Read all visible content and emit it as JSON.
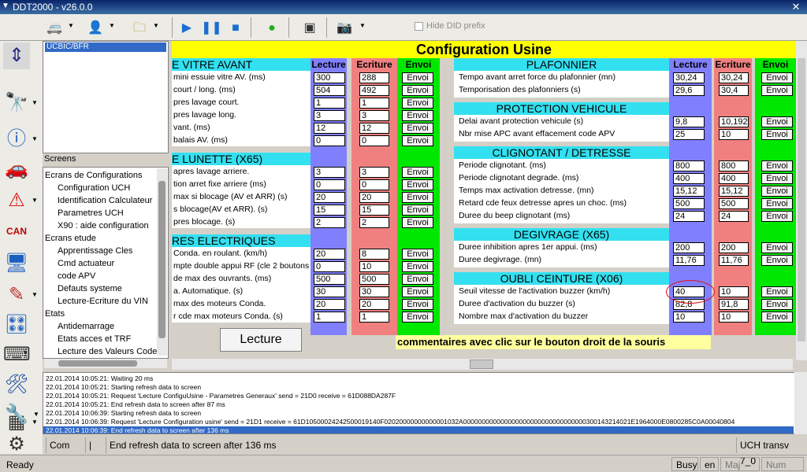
{
  "window": {
    "title": "DDT2000 - v26.0.0",
    "close": "✕"
  },
  "toolbar": {
    "hide_did_prefix": "Hide DID prefix"
  },
  "tree": {
    "selected": "UCBIC/BFR",
    "screens_label": "Screens",
    "items": [
      "Ecrans de Configurations",
      "Configuration UCH",
      "Identification Calculateur",
      "Parametres UCH",
      "X90 : aide configuration",
      "Ecrans etude",
      "Apprentissage Cles",
      "Cmd actuateur",
      "code APV",
      "Defauts systeme",
      "Lecture-Ecriture du VIN",
      "Etats",
      "Antidemarrage",
      "Etats acces et TRF",
      "Lecture des Valeurs Codee"
    ]
  },
  "main": {
    "title": "Configuration Usine",
    "lecture_button": "Lecture",
    "comment": "commentaires avec clic sur le bouton droit de la souris",
    "col_headers": {
      "lecture": "Lecture",
      "ecriture": "Ecriture",
      "envoi": "Envoi"
    },
    "envoi": "Envoi",
    "left": {
      "sections": [
        "E VITRE AVANT",
        "E LUNETTE (X65)",
        "RES ELECTRIQUES"
      ],
      "rows": [
        {
          "label": "mini essuie vitre AV. (ms)",
          "lecture": "300",
          "ecriture": "288"
        },
        {
          "label": "court / long. (ms)",
          "lecture": "504",
          "ecriture": "492"
        },
        {
          "label": "pres lavage court.",
          "lecture": "1",
          "ecriture": "1"
        },
        {
          "label": "pres lavage long.",
          "lecture": "3",
          "ecriture": "3"
        },
        {
          "label": "vant. (ms)",
          "lecture": "12",
          "ecriture": "12"
        },
        {
          "label": "balais AV. (ms)",
          "lecture": "0",
          "ecriture": "0"
        },
        {
          "label": "apres lavage arriere.",
          "lecture": "3",
          "ecriture": "3"
        },
        {
          "label": "tion arret fixe arriere (ms)",
          "lecture": "0",
          "ecriture": "0"
        },
        {
          "label": "max si blocage (AV et ARR) (s)",
          "lecture": "20",
          "ecriture": "20"
        },
        {
          "label": "s blocage(AV et ARR). (s)",
          "lecture": "15",
          "ecriture": "15"
        },
        {
          "label": "pres blocage. (s)",
          "lecture": "2",
          "ecriture": "2"
        },
        {
          "label": "Conda. en roulant. (km/h)",
          "lecture": "20",
          "ecriture": "8"
        },
        {
          "label": "mpte double appui RF (cle 2 boutons)",
          "lecture": "0",
          "ecriture": "10"
        },
        {
          "label": "de max des ouvrants. (ms)",
          "lecture": "500",
          "ecriture": "500"
        },
        {
          "label": "a. Automatique. (s)",
          "lecture": "30",
          "ecriture": "30"
        },
        {
          "label": "max des moteurs Conda.",
          "lecture": "20",
          "ecriture": "20"
        },
        {
          "label": "r cde max moteurs Conda. (s)",
          "lecture": "1",
          "ecriture": "1"
        }
      ]
    },
    "right": {
      "sections": [
        "PLAFONNIER",
        "PROTECTION VEHICULE",
        "CLIGNOTANT /  DETRESSE",
        "DEGIVRAGE (X65)",
        "OUBLI CEINTURE (X06)"
      ],
      "rows": [
        {
          "label": "Tempo avant arret force du plafonnier (mn)",
          "lecture": "30,24",
          "ecriture": "30,24"
        },
        {
          "label": "Temporisation des plafonniers (s)",
          "lecture": "29,6",
          "ecriture": "30,4"
        },
        {
          "label": "Delai avant protection vehicule (s)",
          "lecture": "9,8",
          "ecriture": "10,192"
        },
        {
          "label": "Nbr mise APC avant effacement code APV",
          "lecture": "25",
          "ecriture": "10"
        },
        {
          "label": "Periode clignotant. (ms)",
          "lecture": "800",
          "ecriture": "800"
        },
        {
          "label": "Periode clignotant degrade. (ms)",
          "lecture": "400",
          "ecriture": "400"
        },
        {
          "label": "Temps max activation detresse. (mn)",
          "lecture": "15,12",
          "ecriture": "15,12"
        },
        {
          "label": "Retard cde feux detresse apres un choc. (ms)",
          "lecture": "500",
          "ecriture": "500"
        },
        {
          "label": "Duree du beep clignotant (ms)",
          "lecture": "24",
          "ecriture": "24"
        },
        {
          "label": "Duree inhibition apres 1er appui. (ms)",
          "lecture": "200",
          "ecriture": "200"
        },
        {
          "label": "Duree degivrage. (mn)",
          "lecture": "11,76",
          "ecriture": "11,76"
        },
        {
          "label": "Seuil vitesse de l'activation buzzer (km/h)",
          "lecture": "40",
          "ecriture": "10"
        },
        {
          "label": "Duree d'activation du buzzer (s)",
          "lecture": "82,8",
          "ecriture": "91,8"
        },
        {
          "label": "Nombre max d'activation du buzzer",
          "lecture": "10",
          "ecriture": "10"
        }
      ]
    }
  },
  "log": [
    "22.01.2014 10:05:21: Waiting 20 ms",
    "22.01.2014 10:05:21: Starting refresh data to screen",
    "22.01.2014 10:05:21: Request 'Lecture ConfiguUsine - Parametres Generaux' send = 21D0 receive = 61D088DA287F",
    "22.01.2014 10:05:21: End refresh data to screen after 87 ms",
    "22.01.2014 10:06:39: Starting refresh data to screen",
    "22.01.2014 10:06:39: Request 'Lecture Configuration usine' send = 21D1 receive = 61D10500024242500019140F02020000000000001032A000000000000000000000000000000000300143214021E1964000E0800285C0A00040804",
    "22.01.2014 10:06:39: End refresh data to screen after 136 ms"
  ],
  "status": {
    "com": "Com",
    "sep": "|",
    "message": "End refresh data to screen after 136 ms",
    "device": "UCH transv 7_0",
    "ready": "Ready",
    "busy": "Busy",
    "lang": "en",
    "maj": "Maj",
    "num": "Num"
  }
}
